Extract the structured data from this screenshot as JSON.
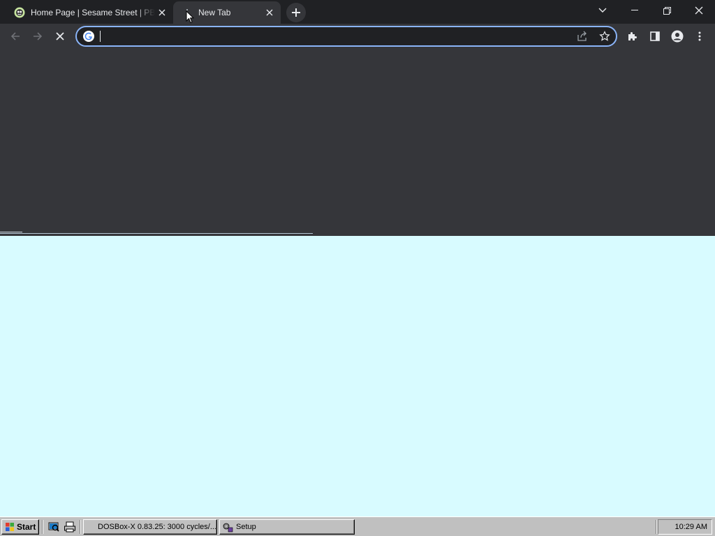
{
  "browser": {
    "tabs": [
      {
        "title": "Home Page | Sesame Street | PBS",
        "icon": "pbs-kids-icon",
        "active": false
      },
      {
        "title": "New Tab",
        "icon": "loading-throbber-icon",
        "active": true
      }
    ],
    "new_tab_icon": "plus-icon",
    "window_controls": [
      "tab-search-icon",
      "minimize-icon",
      "restore-icon",
      "close-icon"
    ],
    "toolbar": {
      "back_icon": "back-arrow-icon",
      "forward_icon": "forward-arrow-icon",
      "stop_icon": "stop-loading-icon",
      "address_value": "",
      "address_placeholder": "",
      "omnibox_icons": [
        "google-icon",
        "share-icon",
        "bookmark-star-icon"
      ],
      "extensions_icon": "puzzle-piece-icon",
      "side_panel_icon": "side-panel-icon",
      "profile_icon": "profile-icon",
      "menu_icon": "kebab-menu-icon"
    },
    "colors": {
      "tabstrip": "#202124",
      "toolbar": "#35363a",
      "focus_ring": "#8ab4f8",
      "desktop": "#d8fbff"
    }
  },
  "taskbar": {
    "start_label": "Start",
    "quick_launch": [
      "show-desktop-icon",
      "printer-icon"
    ],
    "tasks": [
      {
        "label": "DOSBox-X 0.83.25: 3000 cycles/...",
        "icon": "dosbox-icon"
      },
      {
        "label": "Setup",
        "icon": "setup-icon"
      }
    ],
    "clock": "10:29 AM"
  }
}
